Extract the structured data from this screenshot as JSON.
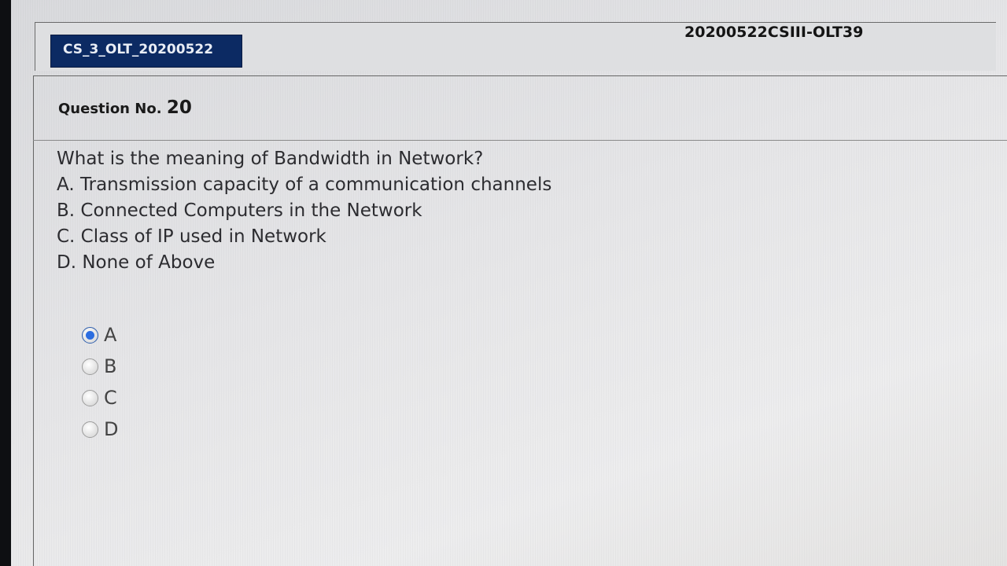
{
  "header": {
    "exam_badge": "CS_3_OLT_20200522",
    "test_code": "20200522CSIII-OLT39"
  },
  "question": {
    "number_label": "Question No.",
    "number": "20",
    "text": "What is the meaning of Bandwidth in Network?",
    "choices": [
      "A. Transmission capacity of a communication channels",
      "B. Connected Computers in the Network",
      "C. Class of IP used in Network",
      "D. None of Above"
    ]
  },
  "answer_options": [
    {
      "label": "A",
      "selected": true
    },
    {
      "label": "B",
      "selected": false
    },
    {
      "label": "C",
      "selected": false
    },
    {
      "label": "D",
      "selected": false
    }
  ],
  "colors": {
    "badge_background": "#0c2a63",
    "radio_selected": "#2c6de0"
  }
}
